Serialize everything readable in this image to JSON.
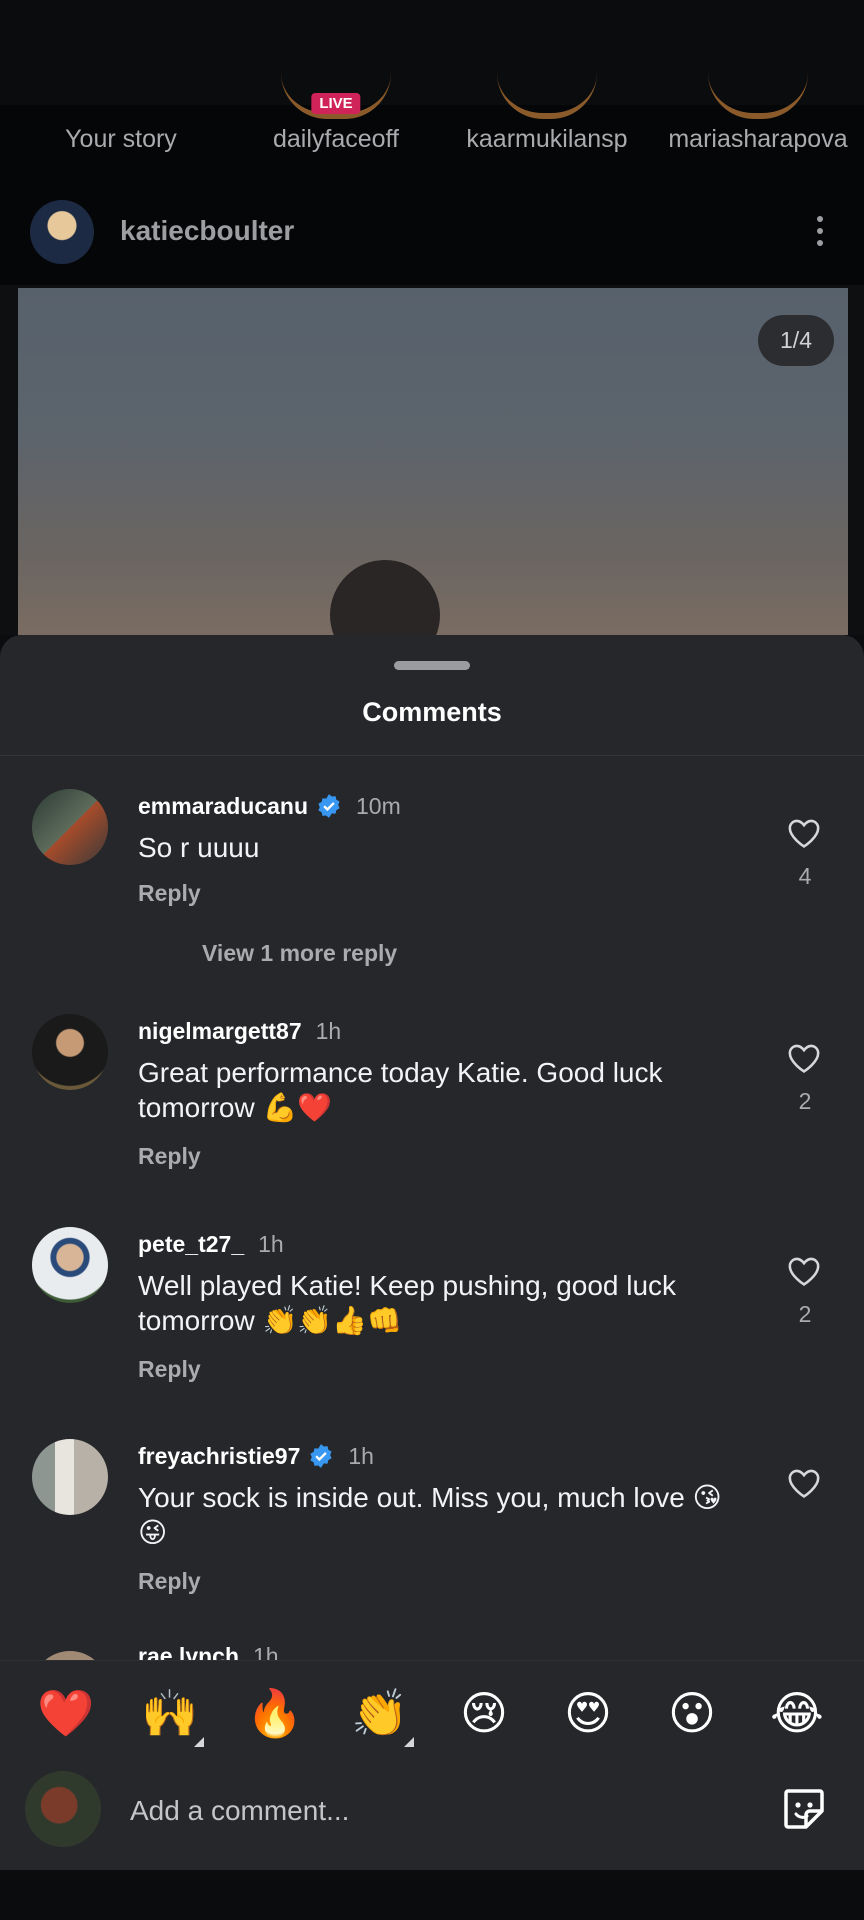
{
  "stories": [
    {
      "label": "Your story"
    },
    {
      "label": "dailyfaceoff",
      "badge": "LIVE"
    },
    {
      "label": "kaarmukilansp"
    },
    {
      "label": "mariasharapova"
    }
  ],
  "post": {
    "username": "katiecboulter",
    "counter": "1/4"
  },
  "comments_sheet": {
    "title": "Comments",
    "reply_label": "Reply",
    "comments": [
      {
        "username": "emmaraducanu",
        "verified": true,
        "time": "10m",
        "text": "So r uuuu",
        "likes": "4",
        "view_more": "View 1 more reply"
      },
      {
        "username": "nigelmargett87",
        "verified": false,
        "time": "1h",
        "text": "Great performance today Katie. Good luck tomorrow 💪❤️",
        "likes": "2"
      },
      {
        "username": "pete_t27_",
        "verified": false,
        "time": "1h",
        "text": "Well played Katie! Keep pushing, good luck tomorrow 👏👏👍👊",
        "likes": "2"
      },
      {
        "username": "freyachristie97",
        "verified": true,
        "time": "1h",
        "text": "Your sock is inside out. Miss you, much love 😘😜",
        "likes": ""
      },
      {
        "username": "rae.lynch",
        "verified": false,
        "time": "1h",
        "text": ""
      }
    ]
  },
  "quick_emojis": [
    "❤️",
    "🙌",
    "🔥",
    "👏",
    "😢",
    "😍",
    "😮",
    "😂"
  ],
  "composer": {
    "placeholder": "Add a comment..."
  },
  "colors": {
    "sheet_bg": "#25272b",
    "verified_blue": "#3897f0",
    "live_badge": "#d0235a"
  }
}
